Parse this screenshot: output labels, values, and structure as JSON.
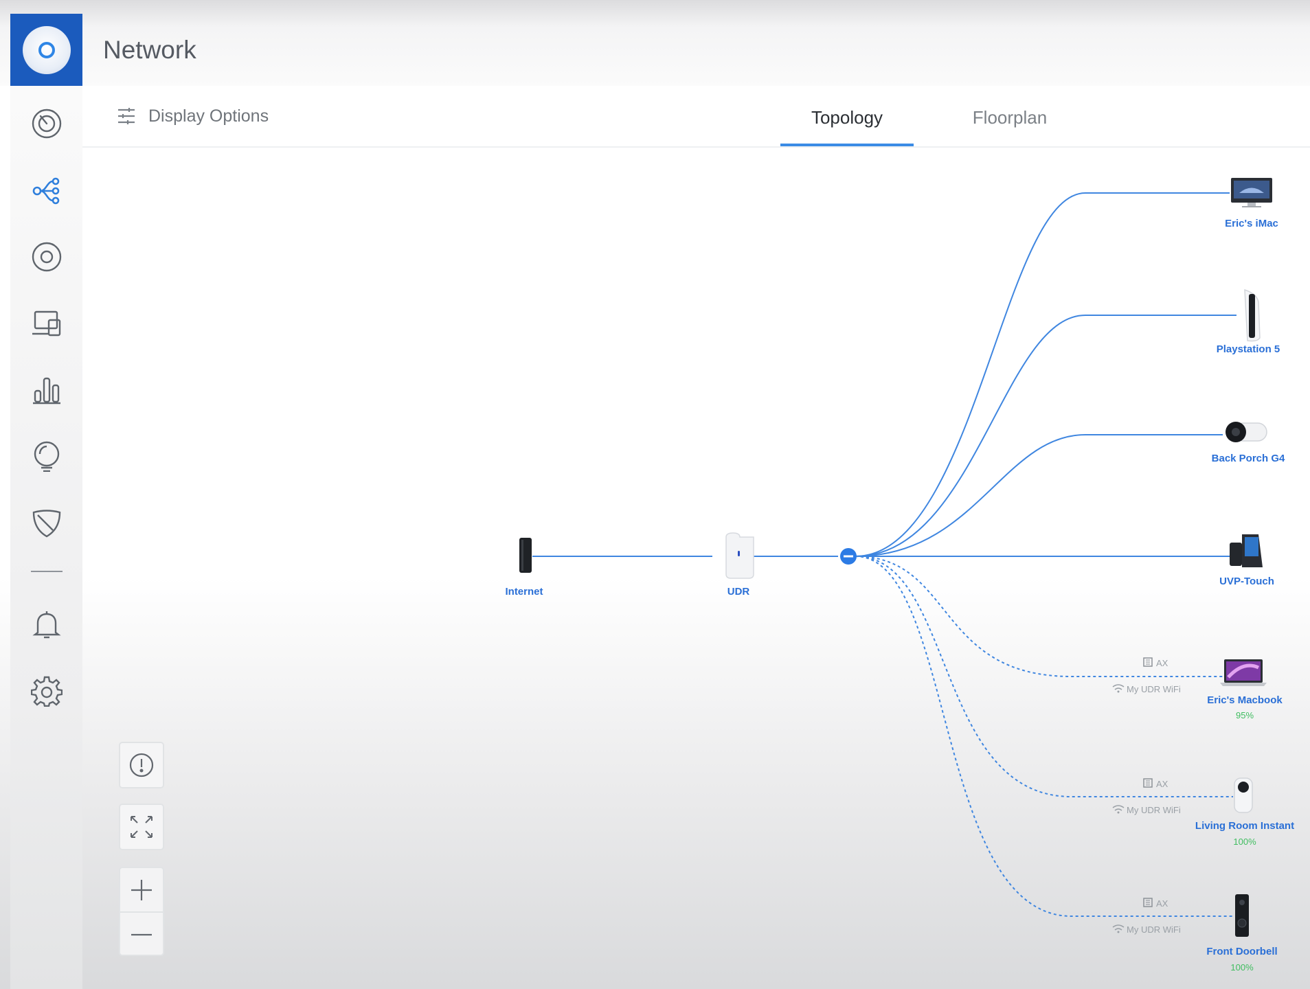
{
  "app": {
    "title": "Network"
  },
  "toolbar": {
    "display_options_label": "Display Options",
    "tabs": [
      {
        "label": "Topology",
        "active": true
      },
      {
        "label": "Floorplan",
        "active": false
      }
    ]
  },
  "sidebar": {
    "items": [
      {
        "icon": "dashboard-gauge-icon",
        "name": "dashboard"
      },
      {
        "icon": "topology-icon",
        "name": "topology",
        "active": true
      },
      {
        "icon": "unifi-devices-icon",
        "name": "unifi-devices"
      },
      {
        "icon": "client-devices-icon",
        "name": "client-devices"
      },
      {
        "icon": "statistics-icon",
        "name": "statistics"
      },
      {
        "icon": "insights-bulb-icon",
        "name": "insights"
      },
      {
        "icon": "security-shield-icon",
        "name": "security"
      },
      {
        "icon": "bell-icon",
        "name": "alerts"
      },
      {
        "icon": "gear-icon",
        "name": "settings"
      }
    ]
  },
  "topology": {
    "internet_label": "Internet",
    "gateway_label": "UDR",
    "wired_clients": [
      {
        "label": "Eric's iMac",
        "icon": "imac-icon"
      },
      {
        "label": "Playstation 5",
        "icon": "playstation-icon"
      },
      {
        "label": "Back Porch G4",
        "icon": "bullet-camera-icon"
      },
      {
        "label": "UVP-Touch",
        "icon": "desk-phone-icon"
      }
    ],
    "wireless_clients": [
      {
        "label": "Eric's Macbook",
        "signal": "95%",
        "radio": "AX",
        "ssid": "My UDR WiFi",
        "icon": "macbook-icon"
      },
      {
        "label": "Living Room Instant",
        "signal": "100%",
        "radio": "AX",
        "ssid": "My UDR WiFi",
        "icon": "instant-camera-icon"
      },
      {
        "label": "Front Doorbell",
        "signal": "100%",
        "radio": "AX",
        "ssid": "My UDR WiFi",
        "icon": "doorbell-icon"
      }
    ],
    "colors": {
      "link": "#3f86e0",
      "label": "#2a6fd6",
      "signal_good": "#3fbd5f",
      "hub": "#2c7be5"
    }
  },
  "controls": [
    {
      "icon": "info-icon",
      "name": "info"
    },
    {
      "icon": "fit-screen-icon",
      "name": "fit-to-screen"
    },
    {
      "icon": "zoom-in-icon",
      "name": "zoom-in"
    },
    {
      "icon": "zoom-out-icon",
      "name": "zoom-out"
    }
  ]
}
